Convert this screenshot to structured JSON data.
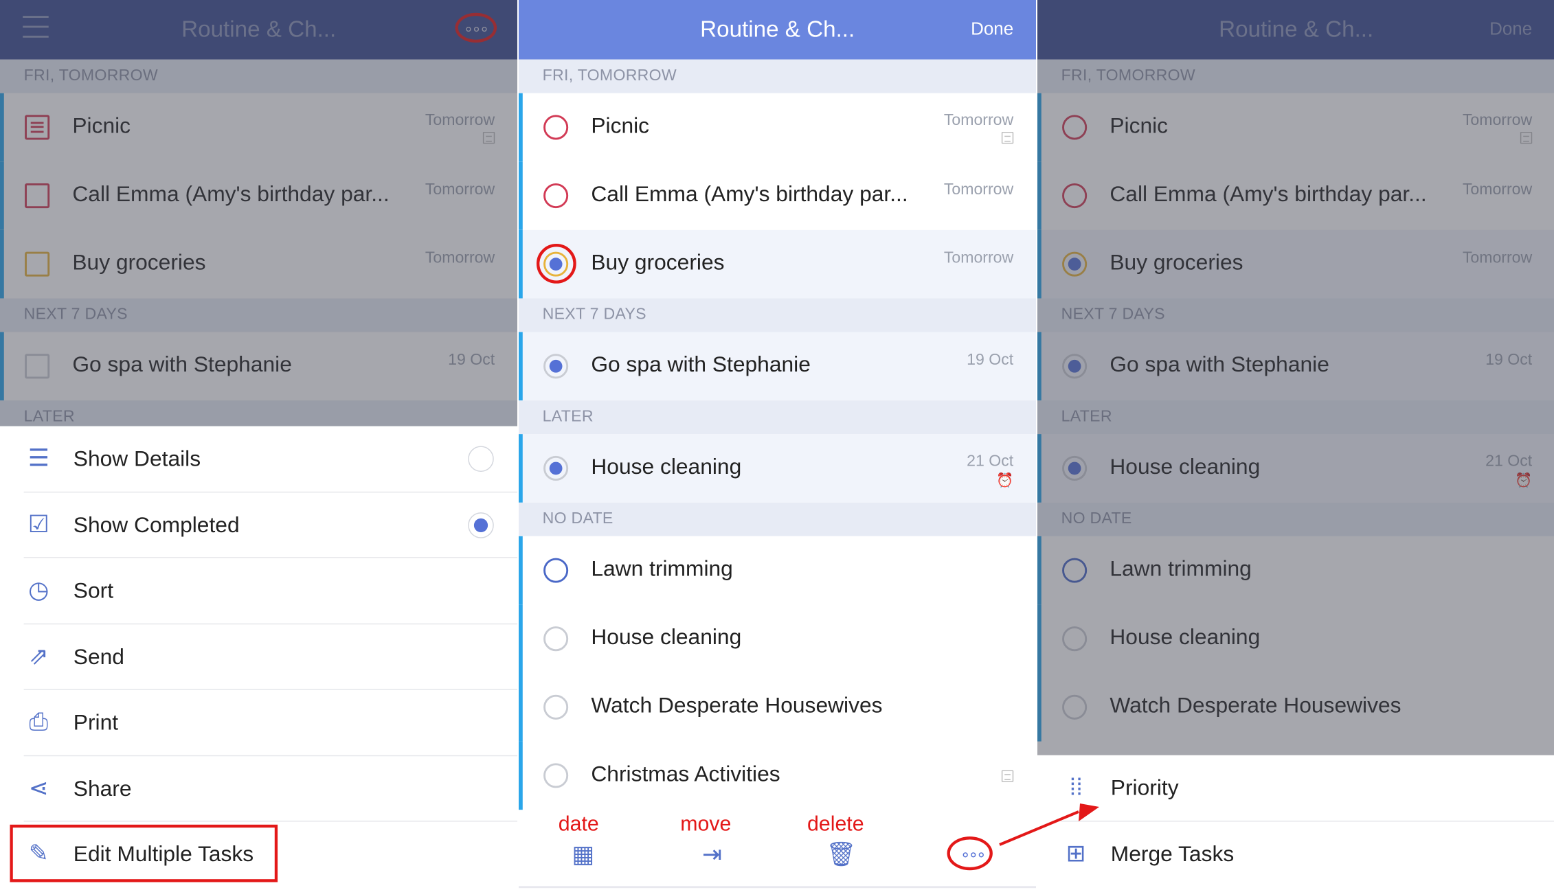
{
  "header": {
    "title": "Routine & Ch...",
    "done_label": "Done"
  },
  "sections": {
    "tomorrow": "FRI, TOMORROW",
    "next7": "NEXT 7 DAYS",
    "later": "LATER",
    "nodate": "NO DATE"
  },
  "tasks": {
    "picnic": {
      "title": "Picnic",
      "date": "Tomorrow"
    },
    "call_emma": {
      "title": "Call Emma (Amy's birthday par...",
      "date": "Tomorrow"
    },
    "groceries": {
      "title": "Buy groceries",
      "date": "Tomorrow"
    },
    "spa": {
      "title": "Go spa with Stephanie",
      "date": "19 Oct"
    },
    "house_cleaning_later": {
      "title": "House cleaning",
      "date": "21 Oct"
    },
    "lawn": {
      "title": "Lawn trimming"
    },
    "house_cleaning": {
      "title": "House cleaning"
    },
    "housewives": {
      "title": "Watch Desperate Housewives"
    },
    "christmas": {
      "title": "Christmas Activities"
    }
  },
  "left_menu": {
    "show_details": "Show Details",
    "show_completed": "Show Completed",
    "sort": "Sort",
    "send": "Send",
    "print": "Print",
    "share": "Share",
    "edit_multiple": "Edit Multiple Tasks"
  },
  "right_menu": {
    "priority": "Priority",
    "merge": "Merge Tasks"
  },
  "toolbar": {
    "date": "date",
    "move": "move",
    "delete": "delete"
  },
  "colors": {
    "header_dark": "#3d4d93",
    "header_light": "#6a86df",
    "accent_blue": "#5571d6",
    "annotation_red": "#e31818"
  }
}
